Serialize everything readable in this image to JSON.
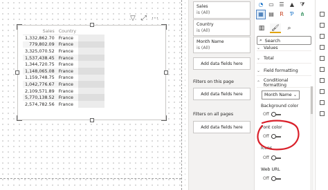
{
  "visual": {
    "columns": [
      "Sales",
      "Country"
    ],
    "rows": [
      {
        "sales": "1,332,862.70",
        "country": "France"
      },
      {
        "sales": "779,802.09",
        "country": "France"
      },
      {
        "sales": "3,325,070.52",
        "country": "France"
      },
      {
        "sales": "1,537,438.45",
        "country": "France"
      },
      {
        "sales": "1,344,720.75",
        "country": "France"
      },
      {
        "sales": "1,148,065.08",
        "country": "France"
      },
      {
        "sales": "1,159,748.75",
        "country": "France"
      },
      {
        "sales": "1,042,776.67",
        "country": "France"
      },
      {
        "sales": "2,109,571.89",
        "country": "France"
      },
      {
        "sales": "5,770,138.52",
        "country": "France"
      },
      {
        "sales": "2,574,782.56",
        "country": "France"
      }
    ],
    "toolbar_icons": [
      "filter-icon",
      "focus-mode-icon",
      "more-options-icon"
    ]
  },
  "filters": {
    "cards": [
      {
        "name": "Sales",
        "value": "is (All)"
      },
      {
        "name": "Country",
        "value": "is (All)"
      },
      {
        "name": "Month Name",
        "value": "is (All)"
      }
    ],
    "add_fields": "Add data fields here",
    "on_this_page": "Filters on this page",
    "on_all_pages": "Filters on all pages"
  },
  "visualizations": {
    "tabs": [
      "fields-tab-icon",
      "format-paint-icon",
      "analytics-icon"
    ],
    "search_placeholder": "Search",
    "sections": {
      "values": "Values",
      "total": "Total",
      "field_formatting": "Field formatting",
      "conditional_formatting": "Conditional formatting"
    },
    "dropdown_value": "Month Name",
    "properties": [
      {
        "label": "Background color",
        "state": "Off"
      },
      {
        "label": "Font color",
        "state": "Off"
      },
      {
        "label": "Icons",
        "state": "Off"
      },
      {
        "label": "Web URL",
        "state": "Off"
      }
    ],
    "annotation_color": "#d9202a"
  },
  "colors": {
    "accent": "#e2a400",
    "selected_icon": "#4f84c4",
    "pane_bg": "#f3f2f1"
  }
}
